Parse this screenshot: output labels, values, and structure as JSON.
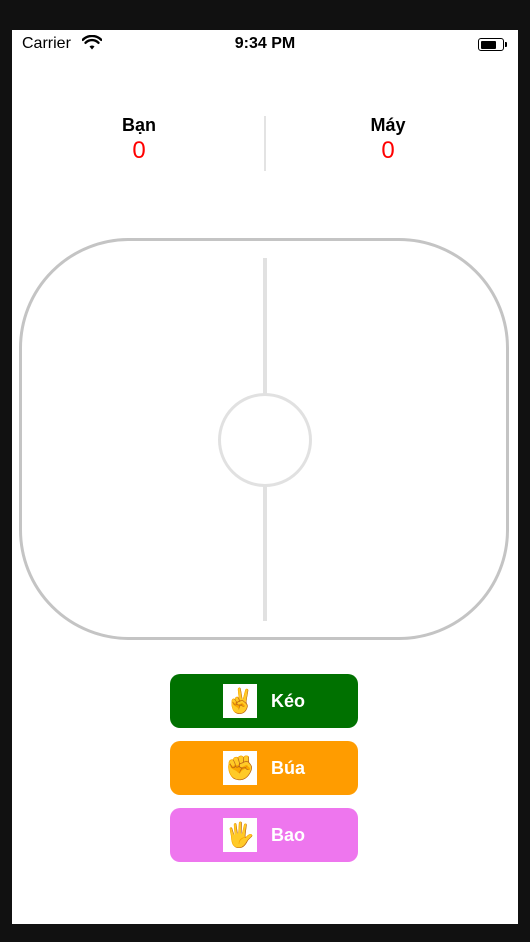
{
  "status_bar": {
    "carrier": "Carrier",
    "time": "9:34 PM"
  },
  "scoreboard": {
    "player": {
      "label": "Bạn",
      "score": "0"
    },
    "computer": {
      "label": "Máy",
      "score": "0"
    }
  },
  "choices": [
    {
      "label": "Kéo",
      "icon": "scissors-hand-icon",
      "glyph": "✌️",
      "color": "#007100"
    },
    {
      "label": "Búa",
      "icon": "rock-fist-icon",
      "glyph": "✊",
      "color": "#ff9c00"
    },
    {
      "label": "Bao",
      "icon": "paper-hand-icon",
      "glyph": "🖐️",
      "color": "#ee76ee"
    }
  ]
}
